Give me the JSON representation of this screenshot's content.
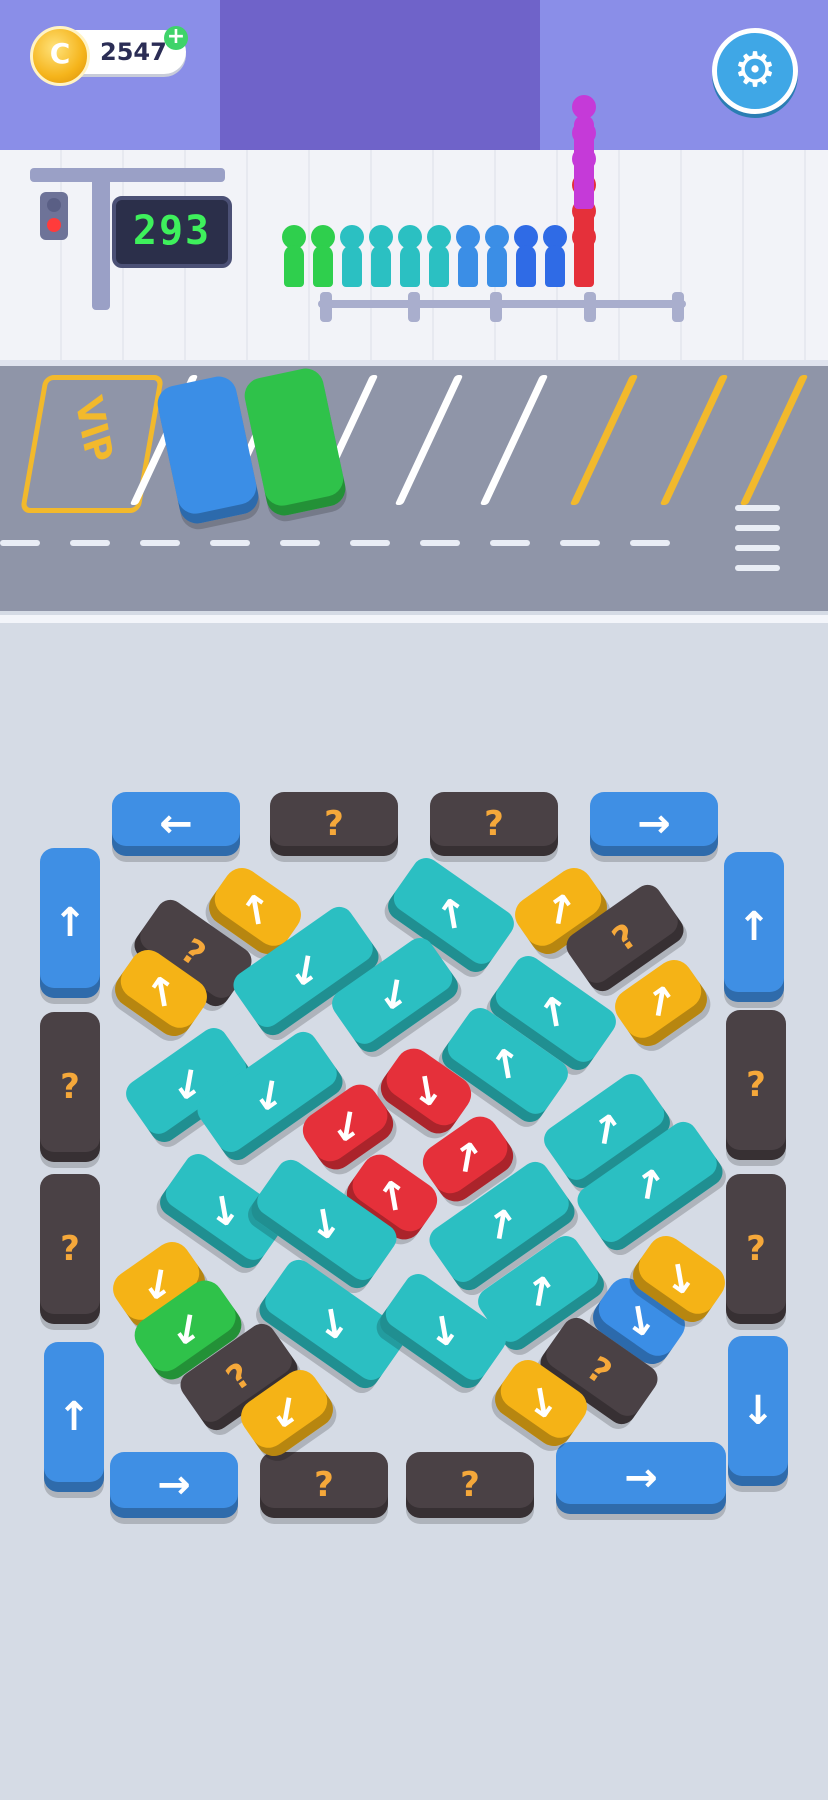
{
  "hud": {
    "coins": "2547",
    "plus_label": "+",
    "coin_glyph": "C",
    "settings_icon": "gear-icon",
    "counter": "293"
  },
  "parking": {
    "vip_label": "VIP"
  },
  "queue": {
    "colors": [
      "#2fcf4d",
      "#2fcf4d",
      "#2bc0c2",
      "#2bc0c2",
      "#2bc0c2",
      "#2bc0c2",
      "#3b8ee6",
      "#3b8ee6",
      "#2f6be6",
      "#2f6be6",
      "#e5303a"
    ],
    "stack_colors": [
      "#e5303a",
      "#e5303a",
      "#c53ad8",
      "#c53ad8",
      "#c53ad8"
    ]
  },
  "vehicles": {
    "up": "↑",
    "down": "↓",
    "left": "←",
    "right": "→",
    "ul": "↖",
    "ur": "↗",
    "dl": "↙",
    "dr": "↘",
    "mystery": "?"
  },
  "colors": {
    "blue_bus": "#3f8fe4",
    "dark_bus": "#4a4145",
    "teal_bus": "#2bbfc2",
    "yellow_car": "#f5b316",
    "red_car": "#e5303a",
    "green_car": "#2fc24a"
  }
}
